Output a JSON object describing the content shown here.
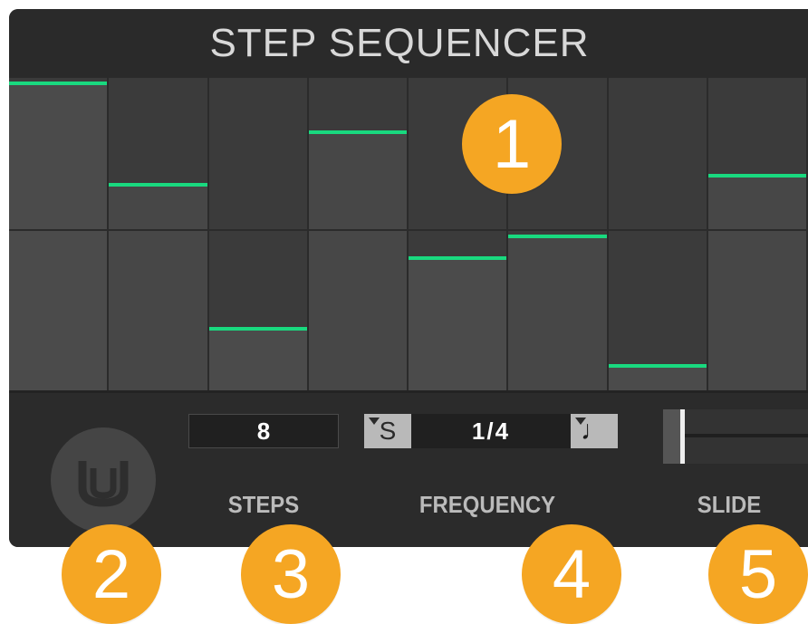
{
  "title": "STEP SEQUENCER",
  "sequencer": {
    "steps": [
      {
        "level": 1.0
      },
      {
        "level": 0.67
      },
      {
        "level": 0.2
      },
      {
        "level": 0.84
      },
      {
        "level": 0.43
      },
      {
        "level": 0.5
      },
      {
        "level": 0.08
      },
      {
        "level": 0.7
      }
    ]
  },
  "controls": {
    "steps_value": "8",
    "steps_label": "STEPS",
    "sync_button_label": "S",
    "frequency_value": "1/4",
    "note_button_glyph": "♩",
    "frequency_label": "FREQUENCY",
    "slide_label": "SLIDE",
    "slide_amount": 0.12
  },
  "callouts": [
    "1",
    "2",
    "3",
    "4",
    "5"
  ],
  "colors": {
    "accent": "#19d97f",
    "callout": "#f5a623",
    "panel": "#2e2e2e"
  },
  "icons": {
    "logo": "u-logo-icon"
  }
}
